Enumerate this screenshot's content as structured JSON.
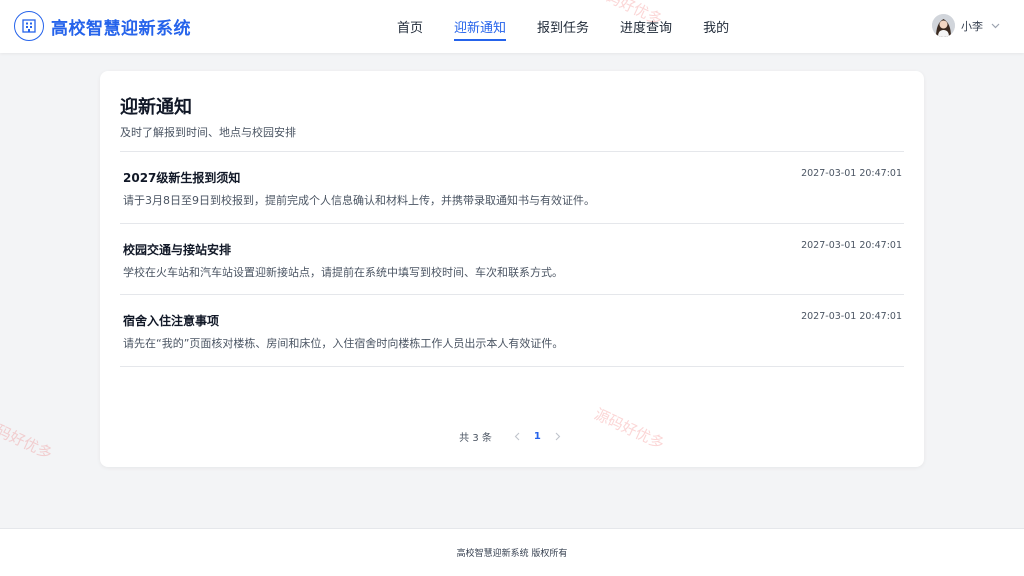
{
  "header": {
    "title": "高校智慧迎新系统",
    "logo_icon": "building-icon",
    "nav": [
      {
        "label": "首页",
        "active": false
      },
      {
        "label": "迎新通知",
        "active": true
      },
      {
        "label": "报到任务",
        "active": false
      },
      {
        "label": "进度查询",
        "active": false
      },
      {
        "label": "我的",
        "active": false
      }
    ],
    "user": {
      "name": "小李"
    }
  },
  "notices": {
    "title": "迎新通知",
    "subtitle": "及时了解报到时间、地点与校园安排",
    "items": [
      {
        "title": "2027级新生报到须知",
        "desc": "请于3月8日至9日到校报到，提前完成个人信息确认和材料上传，并携带录取通知书与有效证件。",
        "time": "2027-03-01 20:47:01"
      },
      {
        "title": "校园交通与接站安排",
        "desc": "学校在火车站和汽车站设置迎新接站点，请提前在系统中填写到校时间、车次和联系方式。",
        "time": "2027-03-01 20:47:01"
      },
      {
        "title": "宿舍入住注意事项",
        "desc": "请先在“我的”页面核对楼栋、房间和床位，入住宿舍时向楼栋工作人员出示本人有效证件。",
        "time": "2027-03-01 20:47:01"
      }
    ]
  },
  "pagination": {
    "total_label": "共 3 条",
    "current_page": "1"
  },
  "footer": {
    "text": "高校智慧迎新系统 版权所有"
  },
  "watermark": {
    "text": "源码好优多"
  },
  "colors": {
    "accent": "#2563eb",
    "background": "#f3f4f6"
  }
}
